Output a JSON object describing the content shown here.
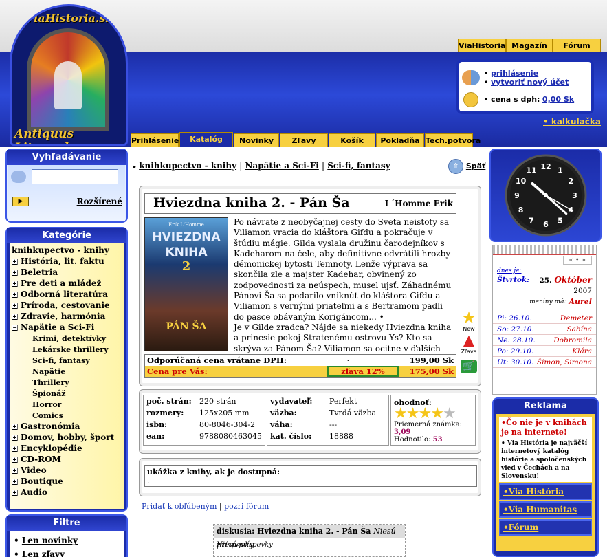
{
  "logo": {
    "top_text": "ViaHistoria.sk",
    "bottom_text": "Antiquus Litera.sk"
  },
  "top_tabs": [
    "ViaHistoria",
    "Magazín",
    "Fórum"
  ],
  "user_box": {
    "login": "prihlásenie",
    "register": "vytvoriť nový účet",
    "price_label": "cena s dph:",
    "price_value": "0,00 Sk"
  },
  "calculator_link": "• kalkulačka",
  "main_nav": [
    "Prihlásenie",
    "Katalóg",
    "Novinky",
    "Zľavy",
    "Košík",
    "Pokladňa",
    "Tech.potvora"
  ],
  "main_nav_active": "Katalóg",
  "search": {
    "title": "Vyhľadávanie",
    "placeholder": "",
    "advanced": "Rozšírené"
  },
  "categories": {
    "title": "Kategórie",
    "root": "knihkupectvo - knihy",
    "items": [
      {
        "label": "História, lit. faktu",
        "mark": "+"
      },
      {
        "label": "Beletria",
        "mark": "+"
      },
      {
        "label": "Pre deti a mládež",
        "mark": "+"
      },
      {
        "label": "Odborná literatúra",
        "mark": "+"
      },
      {
        "label": "Príroda, cestovanie",
        "mark": "+"
      },
      {
        "label": "Zdravie, harmónia",
        "mark": "+"
      },
      {
        "label": "Napätie a Sci-Fi",
        "mark": "−"
      }
    ],
    "subitems": [
      "Krimi, detektívky",
      "Lekárske thrillery",
      "Sci-fi, fantasy",
      "Napätie",
      "Thrillery",
      "Špionáž",
      "Horror",
      "Comics"
    ],
    "items_after": [
      {
        "label": "Gastronómia",
        "mark": "+"
      },
      {
        "label": "Domov, hobby, šport",
        "mark": "+"
      },
      {
        "label": "Encyklopédie",
        "mark": "+"
      },
      {
        "label": "CD-ROM",
        "mark": "+"
      },
      {
        "label": "Video",
        "mark": "+"
      },
      {
        "label": "Boutique",
        "mark": "+"
      },
      {
        "label": "Audio",
        "mark": "+"
      }
    ]
  },
  "filters": {
    "title": "Filtre",
    "items": [
      "Len novinky",
      "Len zľavy"
    ]
  },
  "breadcrumb": {
    "b1": "knihkupectvo - knihy",
    "sep": "|",
    "b2": "Napätie a Sci-Fi",
    "b3": "Sci-fi, fantasy"
  },
  "back_label": "Späť",
  "product": {
    "title": "Hviezdna kniha 2. - Pán Ša",
    "author": "L´Homme Erik",
    "cover": {
      "author": "Erik L'Homme",
      "title1": "HVIEZDNA",
      "title2": "KNIHA",
      "num": "2",
      "sub": "PÁN ŠA"
    },
    "description": "Po návrate z neobyčajnej cesty do Sveta neistoty sa Viliamon vracia do kláštora Gifdu a pokračuje v štúdiu mágie. Gilda vyslala družinu čarodejníkov s Kadeharom na čele, aby definitívne odvrátili hrozby démonickej bytosti Temnoty. Lenže výprava sa skončila zle a majster Kadehar, obvinený zo zodpovednosti za neúspech, musel ujsť. Záhadnému Pánovi Ša sa podarilo vniknúť do kláštora Gifdu a Viliamon s vernými priateľmi a s Bertramom padli do pasce obávaným Korigáncom... •",
    "description2": "Je v Gilde zradca? Nájde sa niekedy Hviezdna kniha a prinesie pokoj Stratenému ostrovu Ys? Kto sa skrýva za Pánom Ša? Viliamon sa ocitne v ďalších skúškach a bude musieť využiť veľký talent čarodejníckeho učňa. •",
    "rec_price_label": "Odporúčaná cena vrátane DPH:",
    "rec_price_dot": "·",
    "rec_price": "199,00 Sk",
    "your_price_label": "Cena pre Vás:",
    "discount": "zľava 12%",
    "your_price": "175,00 Sk",
    "icon_new": "New",
    "icon_warn": "Zľava"
  },
  "details_left": [
    [
      "poč. strán:",
      "220 strán"
    ],
    [
      "rozmery:",
      "125x205 mm"
    ],
    [
      "isbn:",
      "80-8046-304-2"
    ],
    [
      "ean:",
      "9788080463045"
    ]
  ],
  "details_mid": [
    [
      "vydavateľ:",
      "Perfekt"
    ],
    [
      "väzba:",
      "Tvrdá väzba"
    ],
    [
      "váha:",
      "---"
    ],
    [
      "kat. číslo:",
      "18888"
    ]
  ],
  "rating": {
    "label": "ohodnoť:",
    "stars": 4,
    "avg_label": "Priemerná známka:",
    "avg": "3,09",
    "count_label": "Hodnotilo:",
    "count": "53"
  },
  "sample": {
    "label": "ukážka z knihy, ak je dostupná:",
    "text": "."
  },
  "links": {
    "fav": "Pridať k obľúbeným",
    "sep": "|",
    "forum": "pozri fórum"
  },
  "discussion": {
    "title": "diskusia: Hviezdna kniha 2. - Pán Ša",
    "title_note": "Niesú príspevky",
    "body": "Niesú príspevky"
  },
  "clock": {
    "hour": 10,
    "minute": 22,
    "second": 20
  },
  "calendar": {
    "nav": "« • »",
    "today_label": "dnes je:",
    "weekday": "Štvrtok:",
    "day": "25.",
    "month": "Október",
    "year": "2007",
    "nameday_label": "meniny má:",
    "nameday": "Aurel",
    "rows": [
      [
        "Pi: 26.10.",
        "Demeter"
      ],
      [
        "So: 27.10.",
        "Sabína"
      ],
      [
        "Ne: 28.10.",
        "Dobromila"
      ],
      [
        "Po: 29.10.",
        "Klára"
      ],
      [
        "Ut: 30.10.",
        "Šimon, Simona"
      ]
    ]
  },
  "ad": {
    "title": "Reklama",
    "headline": "•Čo nie je v knihách je na internete!",
    "body": "• Via História je najväčší internetový katalóg histórie a spoločenských vied v Čechách a na Slovensku!",
    "links": [
      "•Via História",
      "•Via Humanitas",
      "•Fórum"
    ]
  }
}
